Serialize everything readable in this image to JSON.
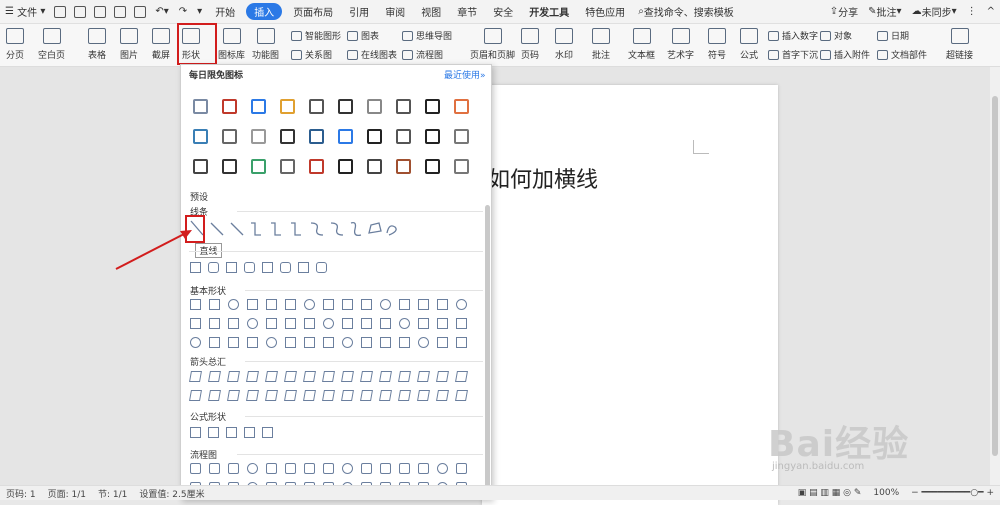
{
  "menubar": {
    "file_label": "文件",
    "tabs": [
      "开始",
      "插入",
      "页面布局",
      "引用",
      "审阅",
      "视图",
      "章节",
      "安全",
      "开发工具",
      "特色应用"
    ],
    "active_tab": "插入",
    "search_placeholder": "查找命令、搜索模板",
    "share": "分享",
    "comment": "批注",
    "sync": "未同步"
  },
  "ribbon": {
    "page_break": "分页",
    "blank_page": "空白页",
    "table": "表格",
    "picture": "图片",
    "screenshot": "截屏",
    "shapes": "形状",
    "icon_lib": "图标库",
    "function_chart": "功能图",
    "smart_graphic": "智能图形",
    "chart": "图表",
    "mind_map": "思维导图",
    "relation_chart": "关系图",
    "online_chart": "在线图表",
    "flowchart": "流程图",
    "header_footer": "页眉和页脚",
    "page_number": "页码",
    "watermark": "水印",
    "comment": "批注",
    "text_box": "文本框",
    "word_art": "艺术字",
    "symbol": "符号",
    "formula": "公式",
    "insert_number": "插入数字",
    "drop_cap": "首字下沉",
    "object": "对象",
    "attachment": "插入附件",
    "date": "日期",
    "doc_parts": "文档部件",
    "hyperlink": "超链接"
  },
  "panel": {
    "daily_icons_title": "每日限免图标",
    "recent_used": "最近使用",
    "preset_title": "预设",
    "lines_title": "线条",
    "tooltip": "直线",
    "basic_shapes_title": "基本形状",
    "arrows_title": "箭头总汇",
    "formula_title": "公式形状",
    "flowchart_title": "流程图"
  },
  "document": {
    "text": "如何加横线"
  },
  "statusbar": {
    "page_num": "页码: 1",
    "pages": "页面: 1/1",
    "section": "节: 1/1",
    "setting": "设置值: 2.5厘米",
    "zoom": "100%"
  },
  "watermark": {
    "brand": "Bai经验",
    "url": "jingyan.baidu.com"
  },
  "colors": {
    "accent": "#2b79e6",
    "highlight": "#d21d1d"
  }
}
